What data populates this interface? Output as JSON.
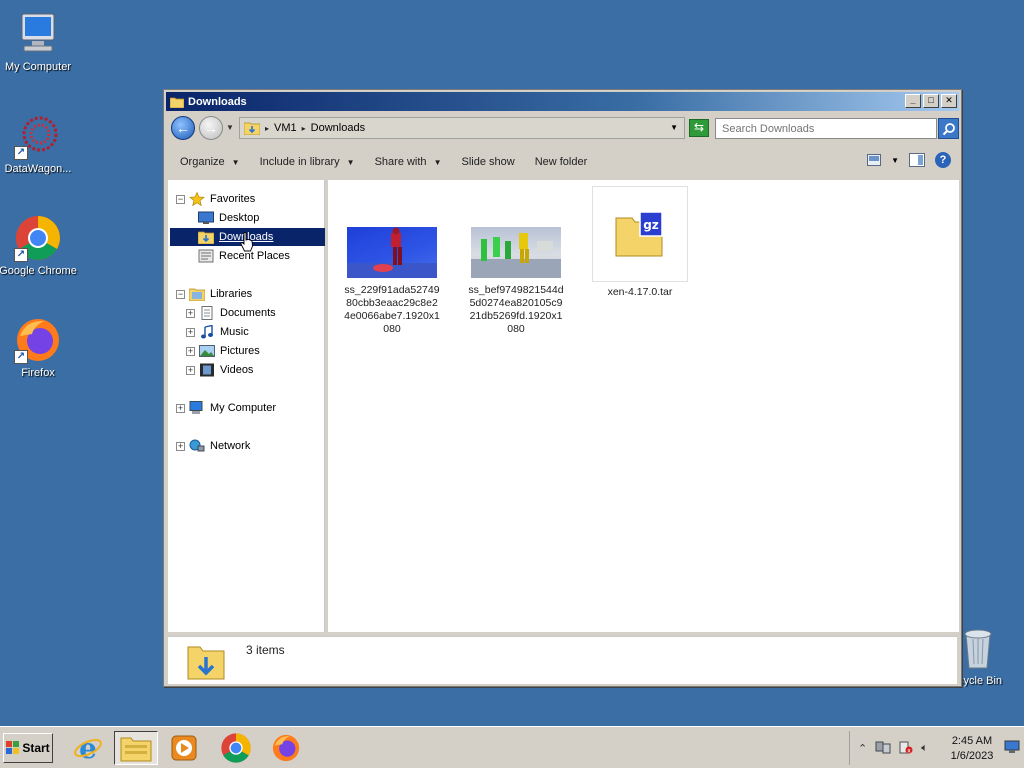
{
  "desktop": {
    "icons": [
      {
        "label": "My Computer"
      },
      {
        "label": "DataWagon..."
      },
      {
        "label": "Google Chrome"
      },
      {
        "label": "Firefox"
      },
      {
        "label": "cycle Bin"
      }
    ]
  },
  "window": {
    "title": "Downloads",
    "address": {
      "root": "VM1",
      "current": "Downloads"
    },
    "search_placeholder": "Search Downloads",
    "toolbar": {
      "organize": "Organize",
      "include_in_library": "Include in library",
      "share_with": "Share with",
      "slide_show": "Slide show",
      "new_folder": "New folder"
    },
    "nav": {
      "favorites": "Favorites",
      "desktop": "Desktop",
      "downloads": "Downloads",
      "recent_places": "Recent Places",
      "libraries": "Libraries",
      "documents": "Documents",
      "music": "Music",
      "pictures": "Pictures",
      "videos": "Videos",
      "my_computer": "My Computer",
      "network": "Network"
    },
    "files": [
      {
        "name": "ss_229f91ada5274980cbb3eaac29c8e24e0066abe7.1920x1080"
      },
      {
        "name": "ss_bef9749821544d5d0274ea820105c921db5269fd.1920x1080"
      },
      {
        "name": "xen-4.17.0.tar"
      }
    ],
    "status": {
      "item_count": "3 items"
    }
  },
  "taskbar": {
    "start": "Start",
    "time": "2:45 AM",
    "date": "1/6/2023"
  }
}
